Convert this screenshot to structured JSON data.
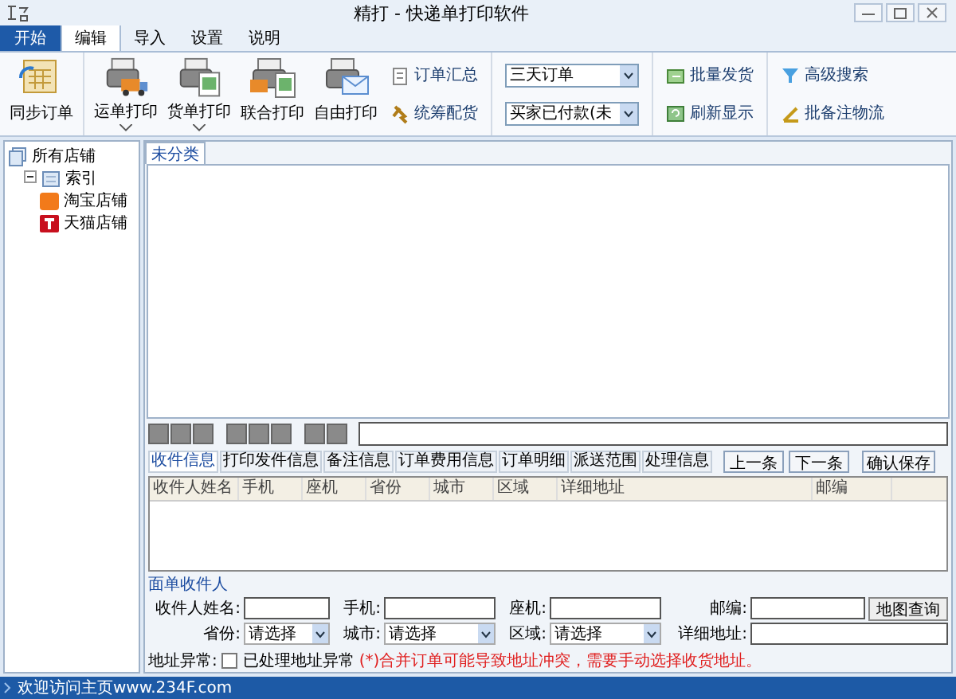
{
  "window": {
    "title": "精打 - 快递单打印软件"
  },
  "menu_tabs": [
    {
      "label": "开始",
      "kind": "start",
      "selected": false
    },
    {
      "label": "编辑",
      "kind": "tab",
      "selected": true
    },
    {
      "label": "导入",
      "kind": "tab",
      "selected": false
    },
    {
      "label": "设置",
      "kind": "tab",
      "selected": false
    },
    {
      "label": "说明",
      "kind": "tab",
      "selected": false
    }
  ],
  "ribbon": {
    "large_buttons": [
      {
        "label": "同步订单",
        "kind": "sync",
        "dropdown": false
      },
      {
        "label": "运单打印",
        "kind": "truck",
        "dropdown": true
      },
      {
        "label": "货单打印",
        "kind": "sheet",
        "dropdown": true
      },
      {
        "label": "联合打印",
        "kind": "combo",
        "dropdown": false
      },
      {
        "label": "自由打印",
        "kind": "free",
        "dropdown": false
      }
    ],
    "small_buttons_1": [
      {
        "label": "订单汇总",
        "kind": "clipboard"
      },
      {
        "label": "统筹配货",
        "kind": "pin"
      }
    ],
    "dropdowns": [
      {
        "value": "三天订单"
      },
      {
        "value": "买家已付款(未"
      }
    ],
    "small_buttons_2": [
      {
        "label": "批量发货",
        "kind": "ship"
      },
      {
        "label": "刷新显示",
        "kind": "refresh"
      }
    ],
    "small_buttons_3": [
      {
        "label": "高级搜索",
        "kind": "filter"
      },
      {
        "label": "批备注物流",
        "kind": "pen"
      }
    ]
  },
  "sidebar": {
    "items": [
      {
        "label": "所有店铺",
        "kind": "root",
        "children": [
          {
            "label": "索引",
            "kind": "folder",
            "expanded": true,
            "children": [
              {
                "label": "淘宝店铺",
                "kind": "taobao"
              },
              {
                "label": "天猫店铺",
                "kind": "tmall"
              }
            ]
          }
        ]
      }
    ]
  },
  "category_tabs": [
    {
      "label": "未分类",
      "selected": true
    }
  ],
  "detail_tabs": [
    {
      "label": "收件信息",
      "selected": true
    },
    {
      "label": "打印发件信息",
      "selected": false
    },
    {
      "label": "备注信息",
      "selected": false
    },
    {
      "label": "订单费用信息",
      "selected": false
    },
    {
      "label": "订单明细",
      "selected": false
    },
    {
      "label": "派送范围",
      "selected": false
    },
    {
      "label": "处理信息",
      "selected": false
    }
  ],
  "nav_buttons": [
    "上一条",
    "下一条"
  ],
  "save_button": "确认保存",
  "table": {
    "columns": [
      "收件人姓名",
      "手机",
      "座机",
      "省份",
      "城市",
      "区域",
      "详细地址",
      "邮编"
    ]
  },
  "recipient_form": {
    "legend": "面单收件人",
    "name_label": "收件人姓名:",
    "mobile_label": "手机:",
    "phone_label": "座机:",
    "zip_label": "邮编:",
    "map_button": "地图查询",
    "province_label": "省份:",
    "province": "请选择",
    "city_label": "城市:",
    "city": "请选择",
    "district_label": "区域:",
    "district": "请选择",
    "address_label": "详细地址:"
  },
  "address_issue": {
    "label": "地址异常:",
    "checkbox_label": "已处理地址异常",
    "checked": false,
    "warning": "(*)合并订单可能导致地址冲突，需要手动选择收货地址。"
  },
  "status_bar": {
    "text": "欢迎访问主页www.234F.com"
  }
}
